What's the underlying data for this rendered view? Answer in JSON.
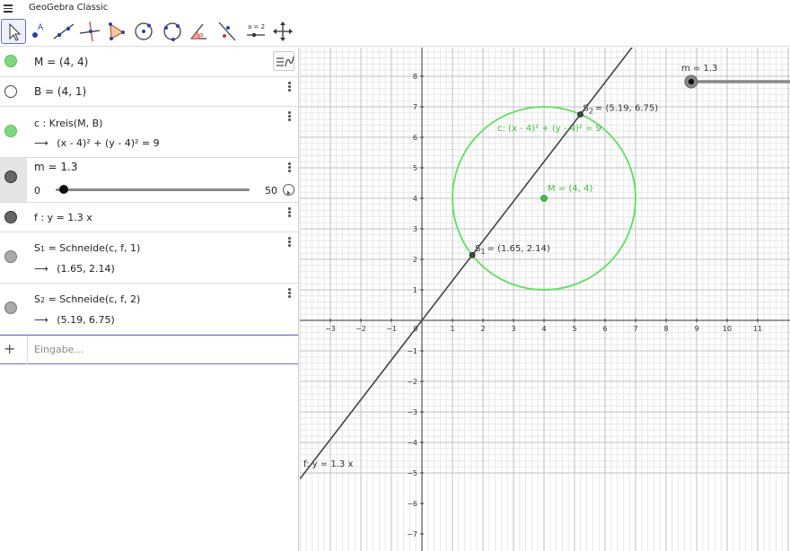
{
  "app": {
    "title": "GeoGebra Classic"
  },
  "toolbar": {
    "tools": [
      "move-tool-icon",
      "point-tool-icon",
      "line-tool-icon",
      "perpendicular-tool-icon",
      "polygon-tool-icon",
      "circle-tool-icon",
      "circle-three-points-tool-icon",
      "angle-tool-icon",
      "reflect-tool-icon",
      "slider-tool-icon",
      "move-graphics-tool-icon"
    ],
    "slider_tool_label": "a = 2"
  },
  "algebra": {
    "m_point": "M = (4, 4)",
    "b_point": "B = (4, 1)",
    "circle_def": "c : Kreis(M, B)",
    "circle_eq": "(x - 4)² + (y - 4)² = 9",
    "slider_label": "m = 1.3",
    "slider_min": "0",
    "slider_max": "50",
    "slider_value": 1.3,
    "line_def": "f : y = 1.3 x",
    "s1_def": "= Schneide(c, f, 1)",
    "s1_val": "(1.65, 2.14)",
    "s2_def": "= Schneide(c, f, 2)",
    "s2_val": "(5.19, 6.75)",
    "input_placeholder": "Eingabe..."
  },
  "graphics": {
    "colors": {
      "circle": "#5ce05c",
      "line": "#444444",
      "grid_major": "#c0c0c0",
      "grid_minor": "#e8e8e8",
      "point_green": "#3fbf3f"
    },
    "x_ticks": [
      -3,
      -2,
      -1,
      0,
      1,
      2,
      3,
      4,
      5,
      6,
      7,
      8,
      9,
      10,
      11
    ],
    "y_ticks": [
      -7,
      -6,
      -5,
      -4,
      -3,
      -2,
      -1,
      1,
      2,
      3,
      4,
      5,
      6,
      7,
      8
    ],
    "circle": {
      "cx": 4,
      "cy": 4,
      "r": 3,
      "label": "c: (x - 4)² + (y - 4)² = 9"
    },
    "line": {
      "slope": 1.3,
      "label": "f: y = 1.3 x"
    },
    "points": [
      {
        "name": "M",
        "x": 4,
        "y": 4,
        "label": "M = (4, 4)"
      },
      {
        "name": "S1",
        "x": 1.65,
        "y": 2.14,
        "label": "= (1.65, 2.14)"
      },
      {
        "name": "S2",
        "x": 5.19,
        "y": 6.75,
        "label": "= (5.19, 6.75)"
      }
    ],
    "slider": {
      "label": "m = 1.3",
      "value": 1.3
    }
  }
}
